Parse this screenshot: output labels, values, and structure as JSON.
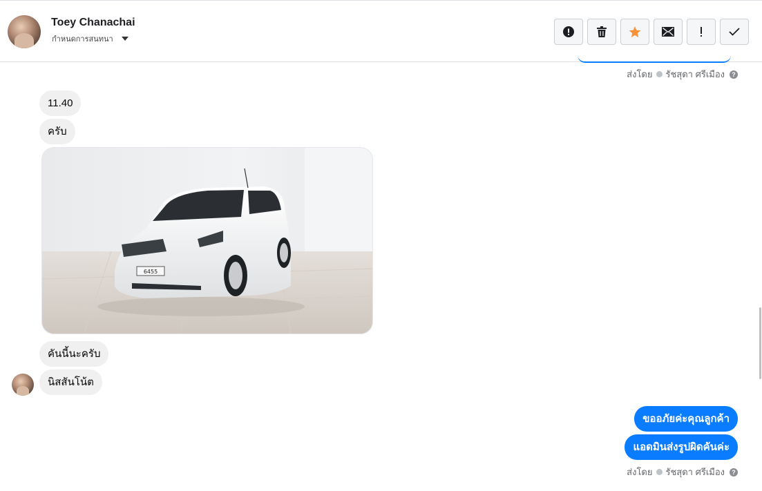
{
  "header": {
    "contact_name": "Toey Chanachai",
    "conversation_label": "กำหนดการสนทนา",
    "actions": [
      {
        "icon": "alert-circle-icon",
        "label": "spam"
      },
      {
        "icon": "trash-icon",
        "label": "delete"
      },
      {
        "icon": "star-icon",
        "label": "star",
        "color": "#f7923a"
      },
      {
        "icon": "envelope-icon",
        "label": "mark unread"
      },
      {
        "icon": "exclamation-icon",
        "label": "follow up"
      },
      {
        "icon": "check-icon",
        "label": "done"
      }
    ]
  },
  "messages": {
    "sent_by_label": "ส่งโดย",
    "agent_name": "รัชสุดา ศรีเมือง",
    "incoming": {
      "m1": "11.40",
      "m2": "ครับ",
      "photo_plate": "6455",
      "m3": "คันนี้นะครับ",
      "m4": "นิสสันโน้ต"
    },
    "outgoing": {
      "m1": "ขออภัยค่ะคุณลูกค้า",
      "m2": "แอดมินส่งรูปผิดคันค่ะ"
    }
  },
  "colors": {
    "accent": "#0a7cff",
    "incoming_bubble": "#f0f0f0",
    "star": "#f7923a"
  }
}
